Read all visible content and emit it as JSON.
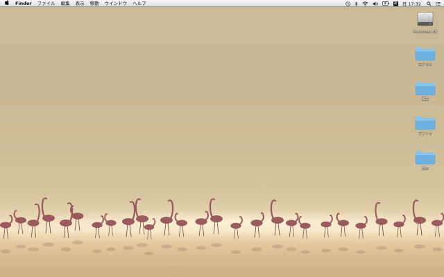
{
  "menubar": {
    "apple_icon": "apple-logo-icon",
    "app_name": "Finder",
    "menus": [
      "ファイル",
      "編集",
      "表示",
      "移動",
      "ウインドウ",
      "ヘルプ"
    ],
    "status": {
      "icons": [
        "time-machine-icon",
        "bluetooth-icon",
        "wifi-icon",
        "volume-icon",
        "battery-icon",
        "input-menu-icon"
      ],
      "input_menu_label": "あ",
      "clock": "日 17:32",
      "search_icon": "spotlight-icon",
      "list_icon": "notification-center-icon"
    }
  },
  "desktop": {
    "icons": [
      {
        "label": "Macintosh HD",
        "type": "hard-drive-icon"
      },
      {
        "label": "ロアセル",
        "type": "folder-icon"
      },
      {
        "label": "編集",
        "type": "folder-icon"
      },
      {
        "label": "マフトラ",
        "type": "folder-icon"
      },
      {
        "label": "画像",
        "type": "folder-icon"
      }
    ]
  },
  "colors": {
    "folder_front": "#6cb1e0",
    "folder_back": "#8cc6ee",
    "menubar_bg": "#efefef",
    "flamingo": "#9a5a5f",
    "sky": "#cab793",
    "glow": "#f6e6c6"
  }
}
